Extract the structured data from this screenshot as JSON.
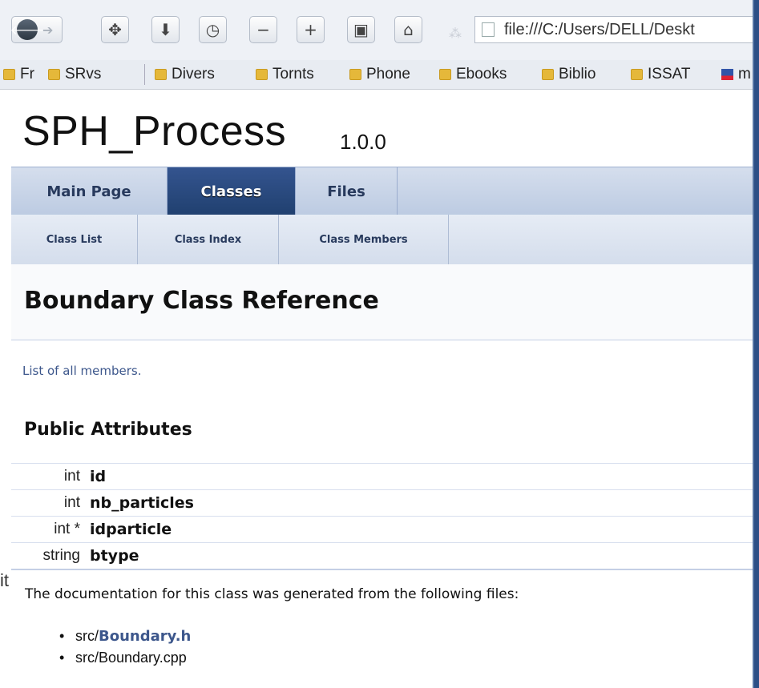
{
  "browser": {
    "url": "file:///C:/Users/DELL/Deskt",
    "toolbar_icons": [
      "back-icon",
      "forward-icon",
      "move-icon",
      "download-icon",
      "history-icon",
      "zoom-out-icon",
      "zoom-in-icon",
      "fullscreen-icon",
      "home-icon",
      "reload-spinner-icon"
    ],
    "toolbar_glyphs": {
      "back": "🡐",
      "forward": "➔",
      "move": "✥",
      "download": "⬇",
      "history": "◷",
      "zoom_out": "−",
      "zoom_in": "+",
      "fullscreen": "▣",
      "home": "⌂",
      "spinner": "⁂"
    },
    "bookmarks": [
      {
        "label": "Fr"
      },
      {
        "label": "SRvs"
      },
      {
        "label": "Divers"
      },
      {
        "label": "Tornts"
      },
      {
        "label": "Phone"
      },
      {
        "label": "Ebooks"
      },
      {
        "label": "Biblio"
      },
      {
        "label": "ISSAT"
      },
      {
        "label": "m"
      }
    ]
  },
  "stray_text": "it",
  "project": {
    "name": "SPH_Process",
    "number": "1.0.0"
  },
  "tabs": [
    {
      "label": "Main Page",
      "current": false
    },
    {
      "label": "Classes",
      "current": true
    },
    {
      "label": "Files",
      "current": false
    }
  ],
  "subtabs": [
    {
      "label": "Class List"
    },
    {
      "label": "Class Index"
    },
    {
      "label": "Class Members"
    }
  ],
  "header": {
    "title": "Boundary Class Reference"
  },
  "all_members_link": "List of all members.",
  "section_title": "Public Attributes",
  "members": [
    {
      "type": "int",
      "name": "id"
    },
    {
      "type": "int",
      "name": "nb_particles"
    },
    {
      "type": "int *",
      "name": "idparticle"
    },
    {
      "type": "string",
      "name": "btype"
    }
  ],
  "doc_text": "The documentation for this class was generated from the following files:",
  "files": [
    {
      "prefix": "src/",
      "name": "Boundary.h",
      "linked": true
    },
    {
      "prefix": "src/",
      "name": "Boundary.cpp",
      "linked": false
    }
  ],
  "colors": {
    "tab_active": "#2a4a80",
    "link": "#3d578c",
    "frame": "#2d4f86"
  }
}
